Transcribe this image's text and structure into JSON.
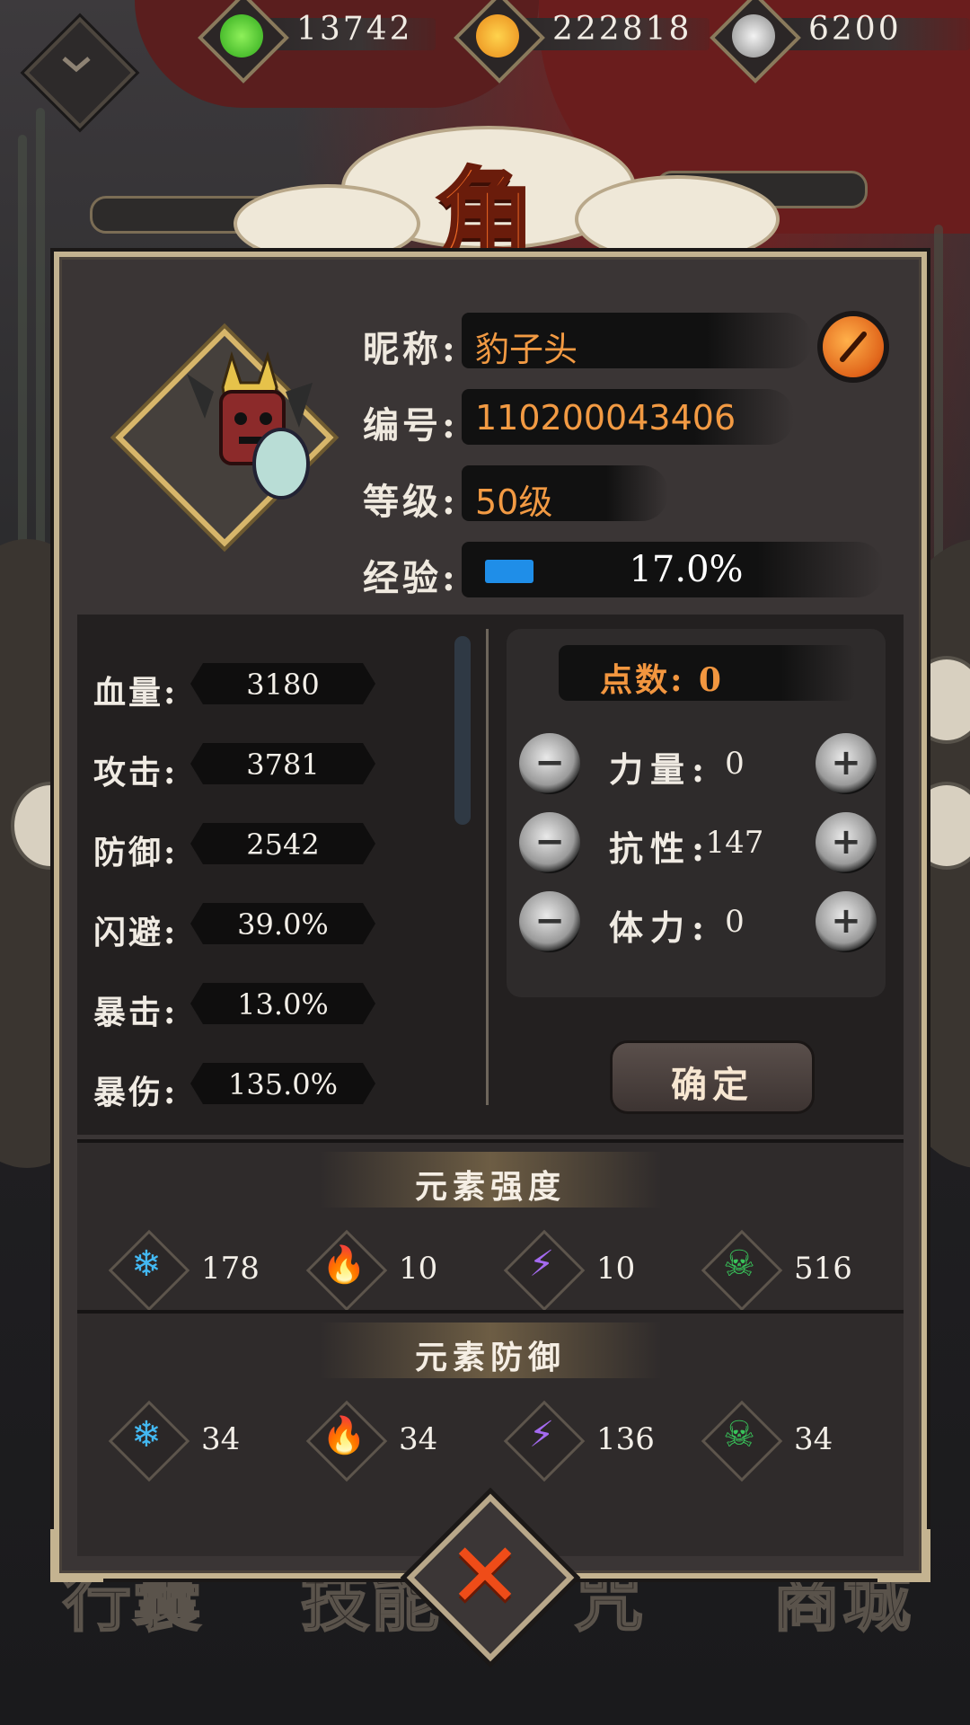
{
  "currencies": [
    {
      "icon": "green-flame-icon",
      "value": "13742",
      "color": "#4fd12b"
    },
    {
      "icon": "gold-coin-icon",
      "value": "222818",
      "color": "#f3a623"
    },
    {
      "icon": "silver-orb-icon",
      "value": "6200",
      "color": "#c8c8c8"
    }
  ],
  "title": "角色",
  "profile": {
    "nickname_label": "昵称:",
    "nickname": "豹子头",
    "id_label": "编号:",
    "id": "110200043406",
    "level_label": "等级:",
    "level": "50级",
    "exp_label": "经验:",
    "exp_percent_text": "17.0%",
    "exp_fraction": 0.17
  },
  "stats": [
    {
      "label": "血量:",
      "value": "3180"
    },
    {
      "label": "攻击:",
      "value": "3781"
    },
    {
      "label": "防御:",
      "value": "2542"
    },
    {
      "label": "闪避:",
      "value": "39.0%"
    },
    {
      "label": "暴击:",
      "value": "13.0%"
    },
    {
      "label": "暴伤:",
      "value": "135.0%"
    }
  ],
  "points": {
    "title": "点数: 0",
    "rows": [
      {
        "label": "力量:",
        "value": "0"
      },
      {
        "label": "抗性:",
        "value": "147"
      },
      {
        "label": "体力:",
        "value": "0"
      }
    ],
    "minus": "−",
    "plus": "+",
    "confirm": "确定"
  },
  "element_strength": {
    "title": "元素强度",
    "items": [
      {
        "icon": "ice-icon",
        "glyph": "❄",
        "color": "#43b8f2",
        "value": "178"
      },
      {
        "icon": "fire-icon",
        "glyph": "🔥",
        "color": "#f07a22",
        "value": "10"
      },
      {
        "icon": "lightning-icon",
        "glyph": "⚡",
        "color": "#a46af0",
        "value": "10"
      },
      {
        "icon": "poison-skull-icon",
        "glyph": "☠",
        "color": "#38c45a",
        "value": "516"
      }
    ]
  },
  "element_defense": {
    "title": "元素防御",
    "items": [
      {
        "icon": "ice-icon",
        "glyph": "❄",
        "color": "#43b8f2",
        "value": "34"
      },
      {
        "icon": "fire-icon",
        "glyph": "🔥",
        "color": "#f07a22",
        "value": "34"
      },
      {
        "icon": "lightning-icon",
        "glyph": "⚡",
        "color": "#a46af0",
        "value": "136"
      },
      {
        "icon": "poison-skull-icon",
        "glyph": "☠",
        "color": "#38c45a",
        "value": "34"
      }
    ]
  },
  "bottom_nav": [
    "行囊",
    "技能",
    "咒",
    "商城"
  ],
  "close": "✕"
}
